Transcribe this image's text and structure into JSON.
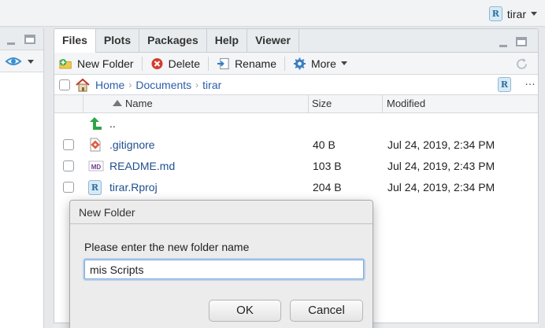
{
  "project": {
    "name": "tirar",
    "icon": "r-project-icon"
  },
  "tabs": [
    {
      "label": "Files",
      "active": true
    },
    {
      "label": "Plots"
    },
    {
      "label": "Packages"
    },
    {
      "label": "Help"
    },
    {
      "label": "Viewer"
    }
  ],
  "toolbar": {
    "new_folder": "New Folder",
    "delete": "Delete",
    "rename": "Rename",
    "more": "More"
  },
  "breadcrumbs": [
    "Home",
    "Documents",
    "tirar"
  ],
  "columns": {
    "name": "Name",
    "size": "Size",
    "modified": "Modified"
  },
  "files": [
    {
      "name": "..",
      "size": "",
      "modified": "",
      "icon": "parent-folder-icon"
    },
    {
      "name": ".gitignore",
      "size": "40 B",
      "modified": "Jul 24, 2019, 2:34 PM",
      "icon": "git-file-icon"
    },
    {
      "name": "README.md",
      "size": "103 B",
      "modified": "Jul 24, 2019, 2:43 PM",
      "icon": "markdown-file-icon"
    },
    {
      "name": "tirar.Rproj",
      "size": "204 B",
      "modified": "Jul 24, 2019, 2:34 PM",
      "icon": "rproj-file-icon"
    }
  ],
  "dialog": {
    "title": "New Folder",
    "prompt": "Please enter the new folder name",
    "value": "mis Scripts",
    "ok": "OK",
    "cancel": "Cancel"
  },
  "colors": {
    "link": "#2c5fa8",
    "accent": "#2b6fa4"
  }
}
